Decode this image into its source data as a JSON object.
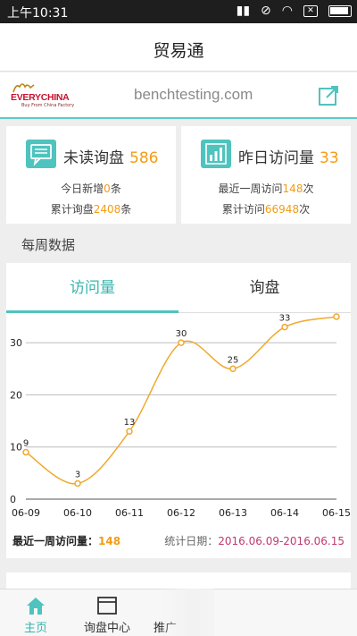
{
  "status_bar": {
    "time": "上午10:31"
  },
  "app": {
    "title": "贸易通"
  },
  "banner": {
    "logo_text": "EVERYCHINA",
    "logo_tagline": "Buy From China Factory",
    "domain": "benchtesting.com"
  },
  "stats": {
    "inquiries": {
      "label": "未读询盘",
      "value": "586",
      "new_today_prefix": "今日新增",
      "new_today": "0",
      "new_today_suffix": "条",
      "total_prefix": "累计询盘",
      "total": "2408",
      "total_suffix": "条"
    },
    "visits": {
      "label": "昨日访问量",
      "value": "33",
      "week_prefix": "最近一周访问",
      "week": "148",
      "week_suffix": "次",
      "total_prefix": "累计访问",
      "total": "66948",
      "total_suffix": "次"
    }
  },
  "section_title": "每周数据",
  "tabs": [
    "访问量",
    "询盘"
  ],
  "chart_data": {
    "type": "line",
    "categories": [
      "06-09",
      "06-10",
      "06-11",
      "06-12",
      "06-13",
      "06-14",
      "06-15"
    ],
    "values": [
      9,
      3,
      13,
      30,
      25,
      33,
      35
    ],
    "ylim": [
      0,
      35
    ],
    "yticks": [
      0,
      10,
      20,
      30
    ],
    "grid": true,
    "color": "#f0a82e"
  },
  "summary": {
    "week_label": "最近一周访问量：",
    "week_value": "148",
    "date_label": "统计日期：",
    "date_range": "2016.06.09-2016.06.15"
  },
  "nav": {
    "items": [
      "主页",
      "询盘中心",
      "推广"
    ]
  },
  "colors": {
    "accent": "#4fc3bd",
    "highlight": "#f39c12",
    "date": "#c0396f"
  }
}
